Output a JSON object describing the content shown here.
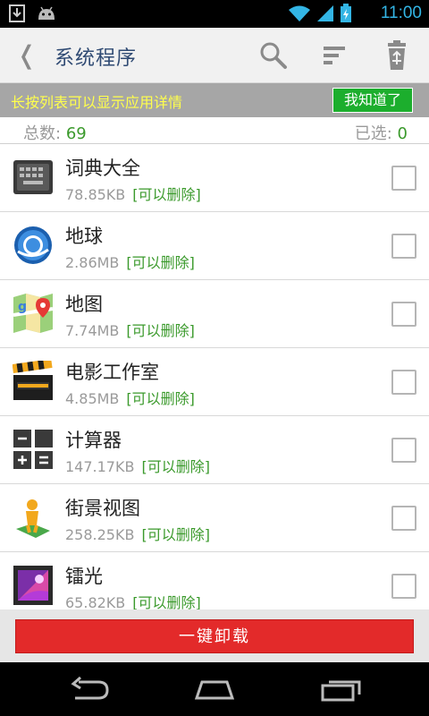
{
  "status_bar": {
    "time": "11:00"
  },
  "action_bar": {
    "back_glyph": "❬",
    "title": "系统程序"
  },
  "hint": {
    "text": "长按列表可以显示应用详情",
    "button_label": "我知道了"
  },
  "counts": {
    "total_label": "总数:",
    "total_value": "69",
    "selected_label": "已选:",
    "selected_value": "0"
  },
  "apps": [
    {
      "name": "词典大全",
      "size": "78.85KB",
      "tag": "[可以删除]",
      "icon": "keyboard-icon"
    },
    {
      "name": "地球",
      "size": "2.86MB",
      "tag": "[可以删除]",
      "icon": "earth-icon"
    },
    {
      "name": "地图",
      "size": "7.74MB",
      "tag": "[可以删除]",
      "icon": "map-icon"
    },
    {
      "name": "电影工作室",
      "size": "4.85MB",
      "tag": "[可以删除]",
      "icon": "clapperboard-icon"
    },
    {
      "name": "计算器",
      "size": "147.17KB",
      "tag": "[可以删除]",
      "icon": "calculator-icon"
    },
    {
      "name": "街景视图",
      "size": "258.25KB",
      "tag": "[可以删除]",
      "icon": "street-view-icon"
    },
    {
      "name": "镭光",
      "size": "65.82KB",
      "tag": "[可以删除]",
      "icon": "gallery-icon"
    }
  ],
  "bottom": {
    "uninstall_label": "一键卸载"
  },
  "colors": {
    "accent_green": "#3b9a2c",
    "uninstall_red": "#e32a2a",
    "hint_yellow": "#ffff4c"
  }
}
